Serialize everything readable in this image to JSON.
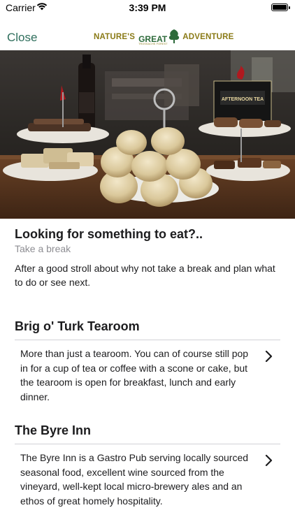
{
  "status_bar": {
    "carrier": "Carrier",
    "time": "3:39 PM"
  },
  "nav": {
    "close_label": "Close",
    "logo": {
      "text_left": "NATURE'S",
      "text_mid": "GREAT",
      "text_right": "ADVENTURE",
      "tagline": "TROSSACHS FOREST"
    }
  },
  "hero": {
    "sign_text": "AFTERNOON TEA"
  },
  "intro": {
    "title": "Looking for something to eat?..",
    "subtitle": "Take a break",
    "body": "After a good stroll about why not take a break and plan what to do or see next."
  },
  "places": [
    {
      "name": "Brig o' Turk Tearoom",
      "description": "More than just a tearoom. You can of course still pop in for a cup of tea or coffee with a scone or cake, but the tearoom is open for breakfast, lunch and early dinner."
    },
    {
      "name": "The Byre Inn",
      "description": "The Byre Inn is a Gastro Pub serving locally sourced seasonal food, excellent wine sourced from the vineyard, well-kept local micro-brewery ales and an ethos of great homely hospitality."
    }
  ],
  "colors": {
    "accent": "#2e6e5c",
    "logo_gold": "#8a7a16",
    "logo_green": "#2d6a3a",
    "muted": "#8e8e93"
  }
}
